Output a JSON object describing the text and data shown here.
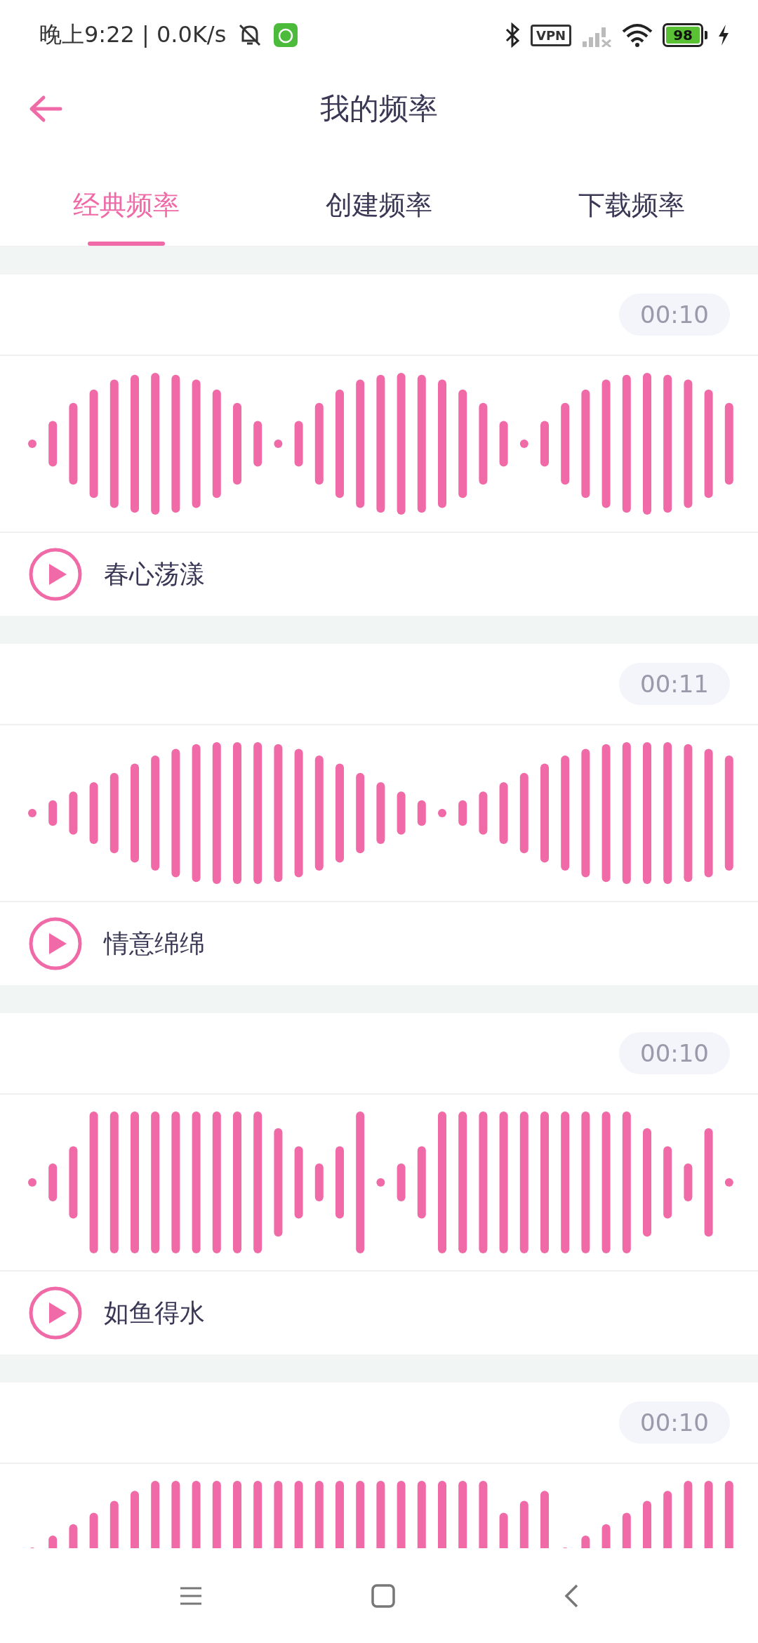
{
  "status_bar": {
    "time_speed": "晚上9:22 | 0.0K/s",
    "vpn": "VPN",
    "battery": "98"
  },
  "header": {
    "title": "我的频率"
  },
  "tabs": [
    {
      "label": "经典频率",
      "selected": true
    },
    {
      "label": "创建频率",
      "selected": false
    },
    {
      "label": "下载频率",
      "selected": false
    }
  ],
  "tracks": [
    {
      "duration": "00:10",
      "name": "春心荡漾"
    },
    {
      "duration": "00:11",
      "name": "情意绵绵"
    },
    {
      "duration": "00:10",
      "name": "如鱼得水"
    },
    {
      "duration": "00:10"
    }
  ]
}
